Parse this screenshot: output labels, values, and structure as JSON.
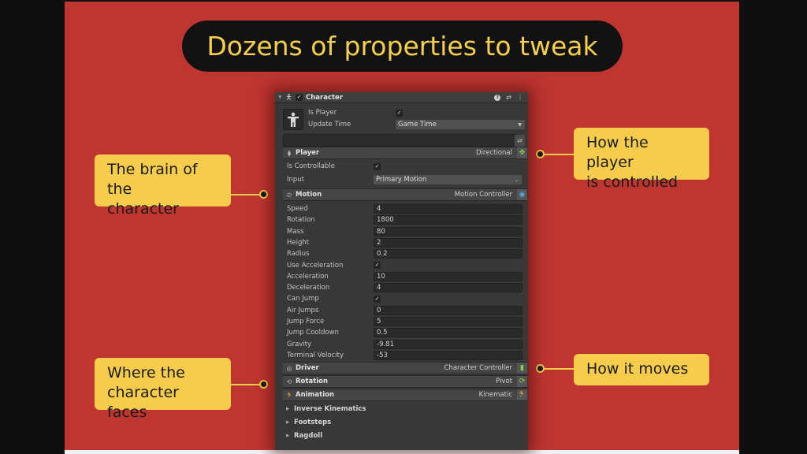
{
  "slide": {
    "title": "Dozens of properties to tweak",
    "colors": {
      "background": "#bf3530",
      "accent": "#f6cc4c",
      "pill": "#121212"
    }
  },
  "callouts": [
    {
      "id": "brain",
      "text_line1": "The brain of the",
      "text_line2": "character"
    },
    {
      "id": "player",
      "text_line1": "How the player",
      "text_line2": "is controlled"
    },
    {
      "id": "faces",
      "text_line1": "Where the",
      "text_line2": "character faces"
    },
    {
      "id": "moves",
      "text_line1": "How it moves"
    }
  ],
  "inspector": {
    "component_title": "Character",
    "enabled": "✓",
    "header_icons": [
      "help-icon",
      "preset-icon",
      "more-icon"
    ],
    "is_player": {
      "label": "Is Player",
      "value": "✓"
    },
    "update_time": {
      "label": "Update Time",
      "value": "Game Time"
    },
    "player_section": {
      "title": "Player",
      "value": "Directional"
    },
    "is_controllable": {
      "label": "Is Controllable",
      "value": "✓"
    },
    "input": {
      "label": "Input",
      "value": "Primary Motion"
    },
    "motion_section": {
      "title": "Motion",
      "value": "Motion Controller"
    },
    "motion_props": [
      {
        "label": "Speed",
        "value": "4",
        "type": "number"
      },
      {
        "label": "Rotation",
        "value": "1800",
        "type": "number"
      },
      {
        "label": "Mass",
        "value": "80",
        "type": "number"
      },
      {
        "label": "Height",
        "value": "2",
        "type": "number"
      },
      {
        "label": "Radius",
        "value": "0.2",
        "type": "number"
      },
      {
        "label": "Use Acceleration",
        "value": "✓",
        "type": "bool"
      },
      {
        "label": "Acceleration",
        "value": "10",
        "type": "number"
      },
      {
        "label": "Deceleration",
        "value": "4",
        "type": "number"
      },
      {
        "label": "Can Jump",
        "value": "✓",
        "type": "bool"
      },
      {
        "label": "Air Jumps",
        "value": "0",
        "type": "number"
      },
      {
        "label": "Jump Force",
        "value": "5",
        "type": "number"
      },
      {
        "label": "Jump Cooldown",
        "value": "0.5",
        "type": "number"
      },
      {
        "label": "Gravity",
        "value": "-9.81",
        "type": "number"
      },
      {
        "label": "Terminal Velocity",
        "value": "-53",
        "type": "number"
      }
    ],
    "driver_section": {
      "title": "Driver",
      "value": "Character Controller"
    },
    "rotation_section": {
      "title": "Rotation",
      "value": "Pivot"
    },
    "animation_section": {
      "title": "Animation",
      "value": "Kinematic"
    },
    "foldouts": [
      "Inverse Kinematics",
      "Footsteps",
      "Ragdoll"
    ],
    "icon_colors": {
      "green": "#8fd14f",
      "blue": "#5aa9e6"
    }
  }
}
